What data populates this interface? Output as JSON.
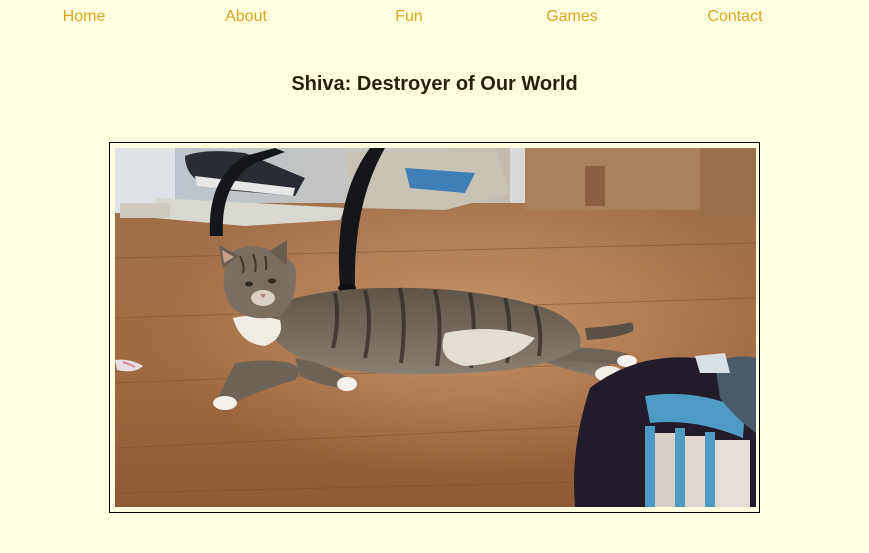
{
  "nav": {
    "items": [
      {
        "label": "Home"
      },
      {
        "label": "About"
      },
      {
        "label": "Fun"
      },
      {
        "label": "Games"
      },
      {
        "label": "Contact"
      }
    ],
    "link_color": "#daa520"
  },
  "page": {
    "title": "Shiva: Destroyer of Our World",
    "background": "#ffffe0"
  },
  "photo": {
    "subject": "tabby cat lying on a wooden floor"
  }
}
